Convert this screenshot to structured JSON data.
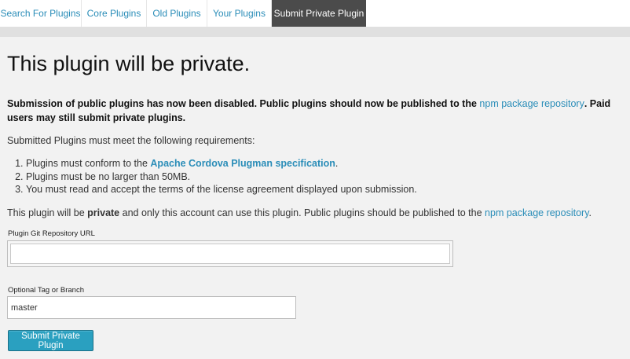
{
  "tabs": [
    {
      "label": "Search For Plugins"
    },
    {
      "label": "Core Plugins"
    },
    {
      "label": "Old Plugins"
    },
    {
      "label": "Your Plugins"
    },
    {
      "label": "Submit Private Plugin",
      "active": true
    }
  ],
  "page": {
    "title": "This plugin will be private.",
    "notice_before": "Submission of public plugins has now been disabled. Public plugins should now be published to the ",
    "notice_link": "npm package repository",
    "notice_after": ". Paid users may still submit private plugins.",
    "requirements_intro": "Submitted Plugins must meet the following requirements:",
    "req1_before": "Plugins must conform to the ",
    "req1_link": "Apache Cordova Plugman specification",
    "req1_after": ".",
    "req2": "Plugins must be no larger than 50MB.",
    "req3": "You must read and accept the terms of the license agreement displayed upon submission.",
    "private_before": "This plugin will be ",
    "private_bold": "private",
    "private_middle": " and only this account can use this plugin. Public plugins should be published to the ",
    "private_link": "npm package repository",
    "private_after": "."
  },
  "form": {
    "repo_label": "Plugin Git Repository URL",
    "repo_value": "",
    "branch_label": "Optional Tag or Branch",
    "branch_value": "master",
    "submit_label": "Submit Private Plugin"
  },
  "colors": {
    "link": "#2a8db8",
    "active_tab": "#4b4b4b",
    "button": "#2aa0c0"
  }
}
